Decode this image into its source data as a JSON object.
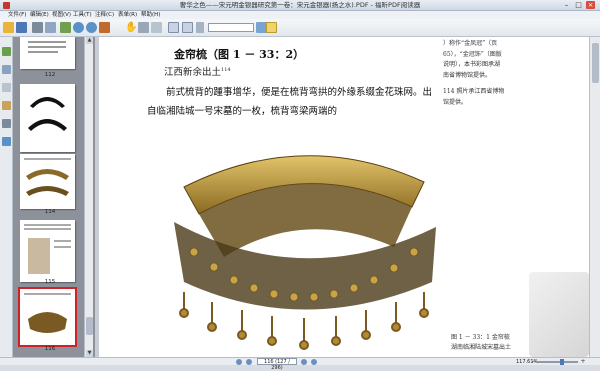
{
  "window": {
    "title": "奢华之色——宋元明金银器研究第一卷：宋元金银器(扬之水).PDF - 福昕PDF阅读器"
  },
  "menu": [
    "文件(F)",
    "编辑(E)",
    "视图(V)",
    "工具(T)",
    "注释(C)",
    "表单(R)",
    "帮助(H)"
  ],
  "thumbnails": [
    {
      "label": "112"
    },
    {
      "label": "113"
    },
    {
      "label": "114"
    },
    {
      "label": "115"
    },
    {
      "label": "116",
      "selected": true
    }
  ],
  "page": {
    "heading": "金帘梳（图 1 － 33：2）",
    "subheading": "江西新余出土",
    "subheading_note": "114",
    "body": "前式梳背的踵事增华，便是在梳背弯拱的外缘系缀金花珠网。出自临湘陆城一号宋墓的一枚，梳背弯梁两端的",
    "side_note_top": "）称作“金凤冠”（页65），“金冠饰”（图版说明），本书彩图承湖南省博物馆提供。",
    "side_note_114": "114 照片承江西省博物馆提供。",
    "caption": "图 1 － 33：1 金帘梳湖南临湘陆城宋墓出土"
  },
  "statusbar": {
    "page_indicator": "116 (127 / 296)",
    "zoom": "117.61%"
  },
  "colors": {
    "selection_border": "#d0202a",
    "panel_background": "#8d929a"
  }
}
